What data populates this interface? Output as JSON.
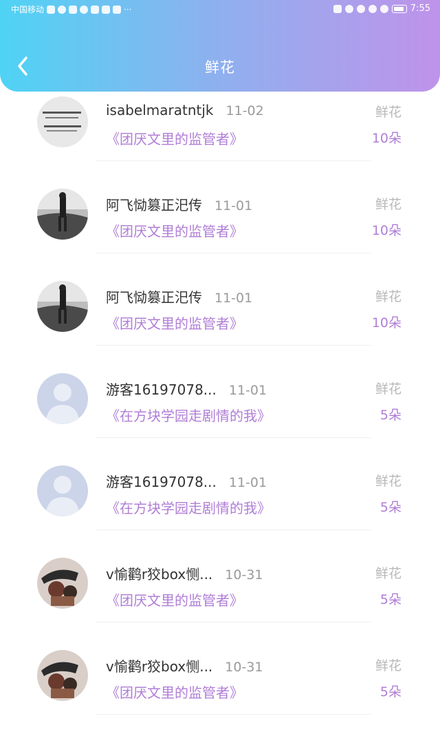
{
  "status_bar": {
    "carrier": "中国移动",
    "time": "7:55"
  },
  "header": {
    "title": "鲜花"
  },
  "colors": {
    "accent_purple": "#b07ed6",
    "gradient_start": "#4fd3f5",
    "gradient_end": "#bf93ea"
  },
  "items": [
    {
      "username": "isabelmaratntjk",
      "date": "11-02",
      "book": "《团厌文里的监管者》",
      "gift": "鲜花",
      "count": "10朵",
      "avatar": "calligraphy-avatar"
    },
    {
      "username": "阿飞恸篡正汜传",
      "date": "11-01",
      "book": "《团厌文里的监管者》",
      "gift": "鲜花",
      "count": "10朵",
      "avatar": "photo-avatar"
    },
    {
      "username": "阿飞恸篡正汜传",
      "date": "11-01",
      "book": "《团厌文里的监管者》",
      "gift": "鲜花",
      "count": "10朵",
      "avatar": "photo-avatar"
    },
    {
      "username": "游客16197078...",
      "date": "11-01",
      "book": "《在方块学园走剧情的我》",
      "gift": "鲜花",
      "count": "5朵",
      "avatar": "default-avatar"
    },
    {
      "username": "游客16197078...",
      "date": "11-01",
      "book": "《在方块学园走剧情的我》",
      "gift": "鲜花",
      "count": "5朵",
      "avatar": "default-avatar"
    },
    {
      "username": "v愉鹳r狡box恻...",
      "date": "10-31",
      "book": "《团厌文里的监管者》",
      "gift": "鲜花",
      "count": "5朵",
      "avatar": "artwork-avatar"
    },
    {
      "username": "v愉鹳r狡box恻...",
      "date": "10-31",
      "book": "《团厌文里的监管者》",
      "gift": "鲜花",
      "count": "5朵",
      "avatar": "artwork-avatar"
    }
  ]
}
